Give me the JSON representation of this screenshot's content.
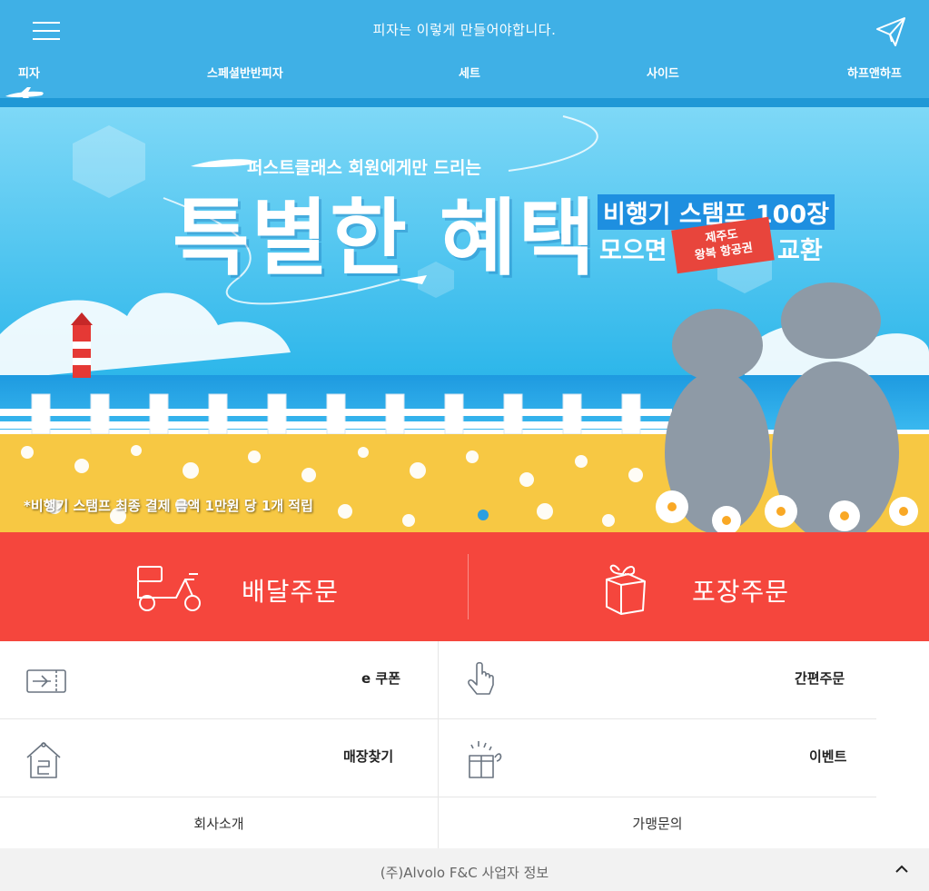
{
  "header": {
    "menu_icon": "hamburger-icon",
    "title": "피자는 이렇게 만들어야합니다.",
    "plane_icon": "paper-plane-icon"
  },
  "nav": {
    "items": [
      {
        "label": "피자"
      },
      {
        "label": "스페셜반반피자"
      },
      {
        "label": "세트"
      },
      {
        "label": "사이드"
      },
      {
        "label": "하프앤하프"
      }
    ],
    "active_index": 0,
    "indicator_icon": "airplane-icon"
  },
  "banner": {
    "subtitle": "퍼스트클래스 회원에게만 드리는",
    "title": "특별한 혜택",
    "stamp_line": "비행기 스탬프 100장",
    "collect_word": "모으면",
    "ticket_line1": "제주도",
    "ticket_line2": "왕복 항공권",
    "exchange_word": "교환",
    "note": "*비행기 스탬프 최종 결제 금액 1만원 당 1개 적립",
    "slide_count": 1
  },
  "order": {
    "delivery_label": "배달주문",
    "delivery_icon": "scooter-icon",
    "takeout_label": "포장주문",
    "takeout_icon": "gift-box-icon"
  },
  "menu_grid": {
    "ecoupon_label": "e 쿠폰",
    "ecoupon_icon": "ticket-icon",
    "quick_order_label": "간편주문",
    "quick_order_icon": "hand-pointer-icon",
    "store_finder_label": "매장찾기",
    "store_finder_icon": "store-icon",
    "event_label": "이벤트",
    "event_icon": "present-icon",
    "company_label": "회사소개",
    "franchise_label": "가맹문의"
  },
  "footer": {
    "text": "(주)Alvolo F&C 사업자 정보",
    "chevron_icon": "chevron-up-icon"
  },
  "colors": {
    "header_blue": "#3fb0e6",
    "order_red": "#f5463d"
  }
}
